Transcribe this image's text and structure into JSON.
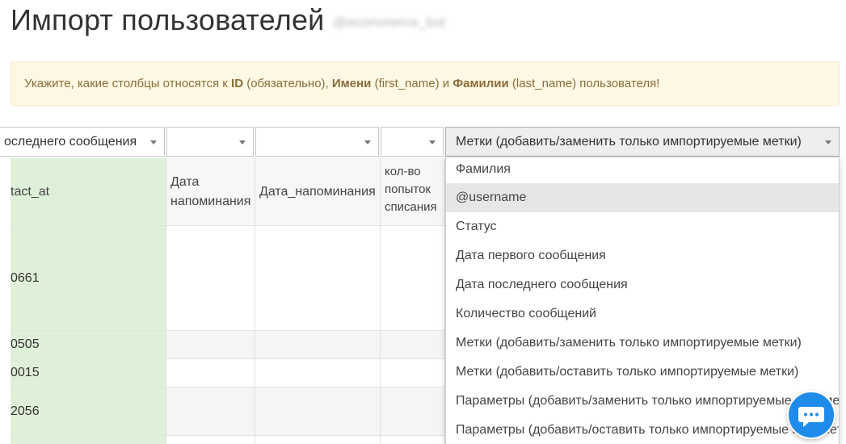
{
  "header": {
    "title": "Импорт пользователей",
    "bot_name": "@ecommerce_bot"
  },
  "alert": {
    "prefix": "Укажите, какие столбцы относятся к ",
    "id": "ID",
    "id_note": " (обязательно), ",
    "first": "Имени",
    "first_note": " (first_name) и ",
    "last": "Фамилии",
    "last_note": " (last_name) пользователя!"
  },
  "selects": [
    {
      "value": "оследнего сообщения"
    },
    {
      "value": ""
    },
    {
      "value": ""
    },
    {
      "value": ""
    },
    {
      "value": "Метки (добавить/заменить только импортируемые метки)"
    }
  ],
  "table": {
    "headers": [
      "tact_at",
      "Дата напоминания",
      "Дата_напоминания",
      "кол-во попыток списания"
    ],
    "first_col_values": [
      "0661",
      "0505",
      "0015",
      "2056"
    ]
  },
  "dropdown": {
    "options": [
      "Фамилия",
      "@username",
      "Статус",
      "Дата первого сообщения",
      "Дата последнего сообщения",
      "Количество сообщений",
      "Метки (добавить/заменить только импортируемые метки)",
      "Метки (добавить/оставить только импортируемые метки)",
      "Параметры (добавить/заменить только импортируемые параметры)",
      "Параметры (добавить/оставить только импортируемые параметры)"
    ],
    "highlighted_index": 1
  },
  "chat": {
    "icon": "chat-bubble-icon"
  },
  "colors": {
    "alert_bg": "#fcf8e3",
    "alert_text": "#8a6d3b",
    "highlight_col": "#dff0d8",
    "chat": "#1f8ceb"
  }
}
